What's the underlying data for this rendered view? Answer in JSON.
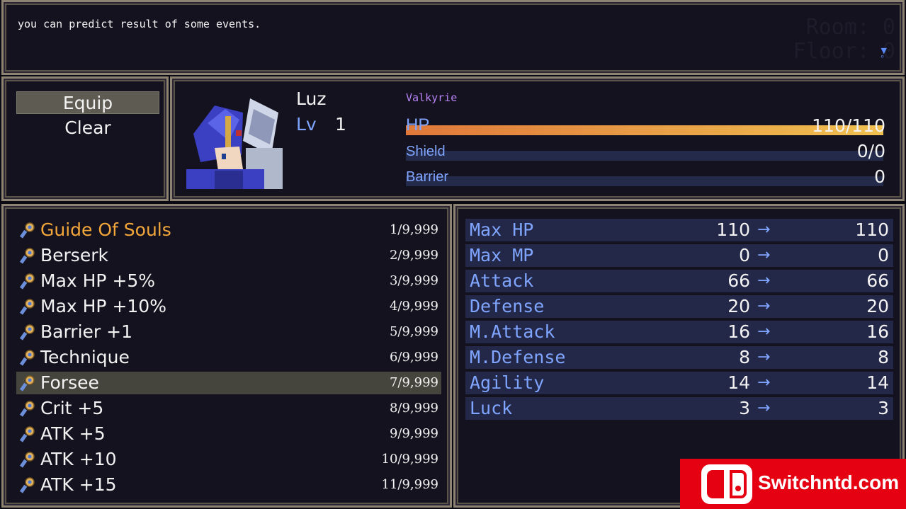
{
  "help": {
    "text": "you can predict result of some events.",
    "room_label": "Room: 0",
    "floor_label": "Floor: 0"
  },
  "commands": [
    {
      "label": "Equip",
      "selected": true
    },
    {
      "label": "Clear",
      "selected": false
    }
  ],
  "actor": {
    "name": "Luz",
    "level_label": "Lv",
    "level": "1",
    "class": "Valkyrie",
    "hp_label": "HP",
    "hp_value": "110/110",
    "hp_fraction": 1.0,
    "shield_label": "Shield",
    "shield_value": "0/0",
    "barrier_label": "Barrier",
    "barrier_value": "0"
  },
  "items": [
    {
      "name": "Guide Of Souls",
      "count": "1/9,999",
      "color": "#f3a73a"
    },
    {
      "name": "Berserk",
      "count": "2/9,999"
    },
    {
      "name": "Max HP +5%",
      "count": "3/9,999"
    },
    {
      "name": "Max HP +10%",
      "count": "4/9,999"
    },
    {
      "name": "Barrier +1",
      "count": "5/9,999"
    },
    {
      "name": "Technique",
      "count": "6/9,999"
    },
    {
      "name": "Forsee",
      "count": "7/9,999",
      "selected": true
    },
    {
      "name": "Crit +5",
      "count": "8/9,999"
    },
    {
      "name": "ATK +5",
      "count": "9/9,999"
    },
    {
      "name": "ATK +10",
      "count": "10/9,999"
    },
    {
      "name": "ATK +15",
      "count": "11/9,999"
    }
  ],
  "stats": [
    {
      "name": "Max HP",
      "current": "110",
      "arrow": "→",
      "new": "110"
    },
    {
      "name": "Max MP",
      "current": "0",
      "arrow": "→",
      "new": "0"
    },
    {
      "name": "Attack",
      "current": "66",
      "arrow": "→",
      "new": "66"
    },
    {
      "name": "Defense",
      "current": "20",
      "arrow": "→",
      "new": "20"
    },
    {
      "name": "M.Attack",
      "current": "16",
      "arrow": "→",
      "new": "16"
    },
    {
      "name": "M.Defense",
      "current": "8",
      "arrow": "→",
      "new": "8"
    },
    {
      "name": "Agility",
      "current": "14",
      "arrow": "→",
      "new": "14"
    },
    {
      "name": "Luck",
      "current": "3",
      "arrow": "→",
      "new": "3"
    }
  ],
  "watermark": {
    "text": "Switchntd.com"
  },
  "colors": {
    "accent": "#7fa5ff",
    "highlight": "#f3a73a",
    "class": "#b784f5",
    "window": "#15121f"
  }
}
